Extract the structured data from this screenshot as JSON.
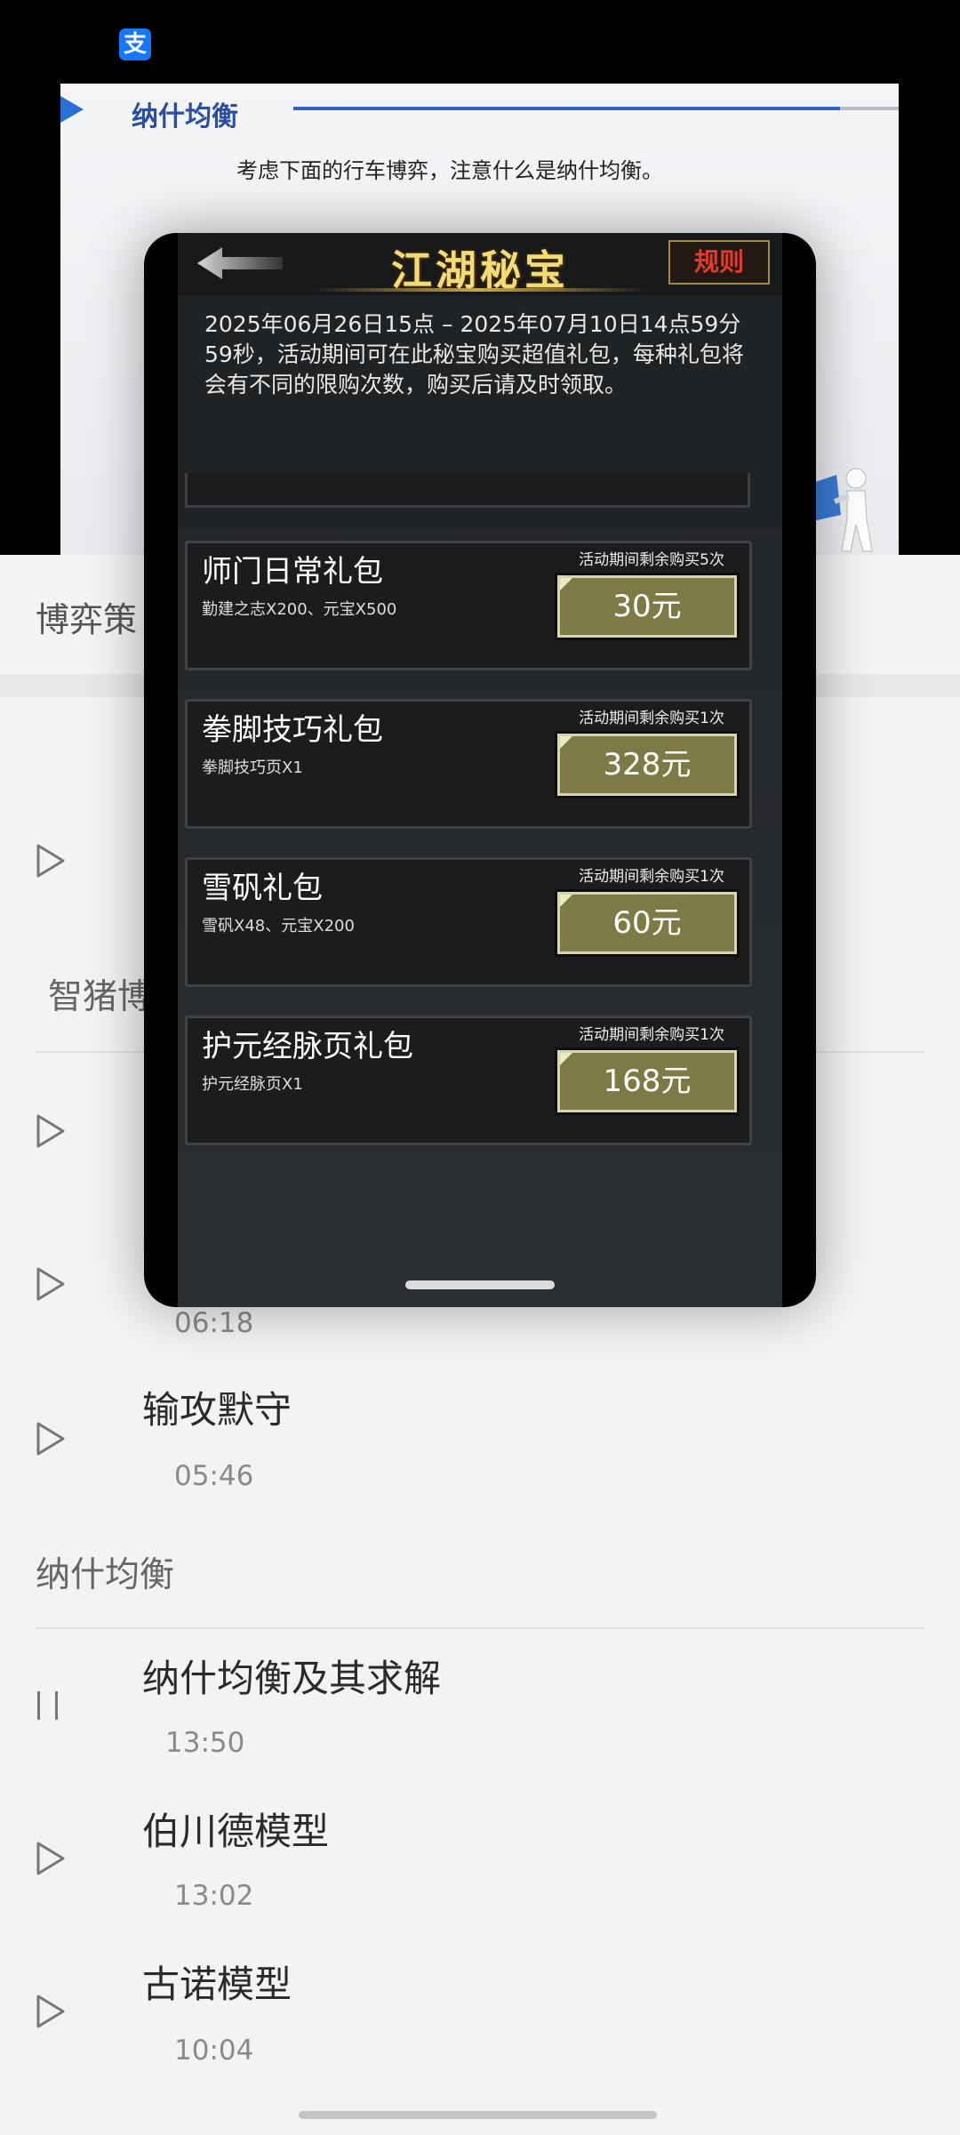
{
  "status_bar": {
    "alipay_icon_glyph": "支"
  },
  "video": {
    "slide_title": "纳什均衡",
    "slide_subtitle": "考虑下面的行车博弈，注意什么是纳什均衡。"
  },
  "sheet": {
    "header_partial": "博弈策",
    "section_partial": "智猪博",
    "lessons_top": [
      {
        "title": "",
        "time": "06:18"
      },
      {
        "title": "输攻默守",
        "time": "05:46"
      }
    ],
    "section2_title": "纳什均衡",
    "lessons": [
      {
        "title": "纳什均衡及其求解",
        "time": "13:50",
        "state": "paused"
      },
      {
        "title": "伯川德模型",
        "time": "13:02",
        "state": "play"
      },
      {
        "title": "古诺模型",
        "time": "10:04",
        "state": "play"
      }
    ]
  },
  "popup": {
    "title": "江湖秘宝",
    "rules_label": "规则",
    "description": "2025年06月26日15点 – 2025年07月10日14点59分59秒，活动期间可在此秘宝购买超值礼包，每种礼包将会有不同的限购次数，购买后请及时领取。",
    "packages": [
      {
        "name": "师门日常礼包",
        "contents": "勤建之志X200、元宝X500",
        "limit": "活动期间剩余购买5次",
        "price": "30元"
      },
      {
        "name": "拳脚技巧礼包",
        "contents": "拳脚技巧页X1",
        "limit": "活动期间剩余购买1次",
        "price": "328元"
      },
      {
        "name": "雪矾礼包",
        "contents": "雪矾X48、元宝X200",
        "limit": "活动期间剩余购买1次",
        "price": "60元"
      },
      {
        "name": "护元经脉页礼包",
        "contents": "护元经脉页X1",
        "limit": "活动期间剩余购买1次",
        "price": "168元"
      }
    ]
  },
  "colors": {
    "price_button": "#7d7a45",
    "title_gold": "#f2dc7a",
    "rules_red": "#e43b2c",
    "slide_blue": "#2b4f9e"
  }
}
